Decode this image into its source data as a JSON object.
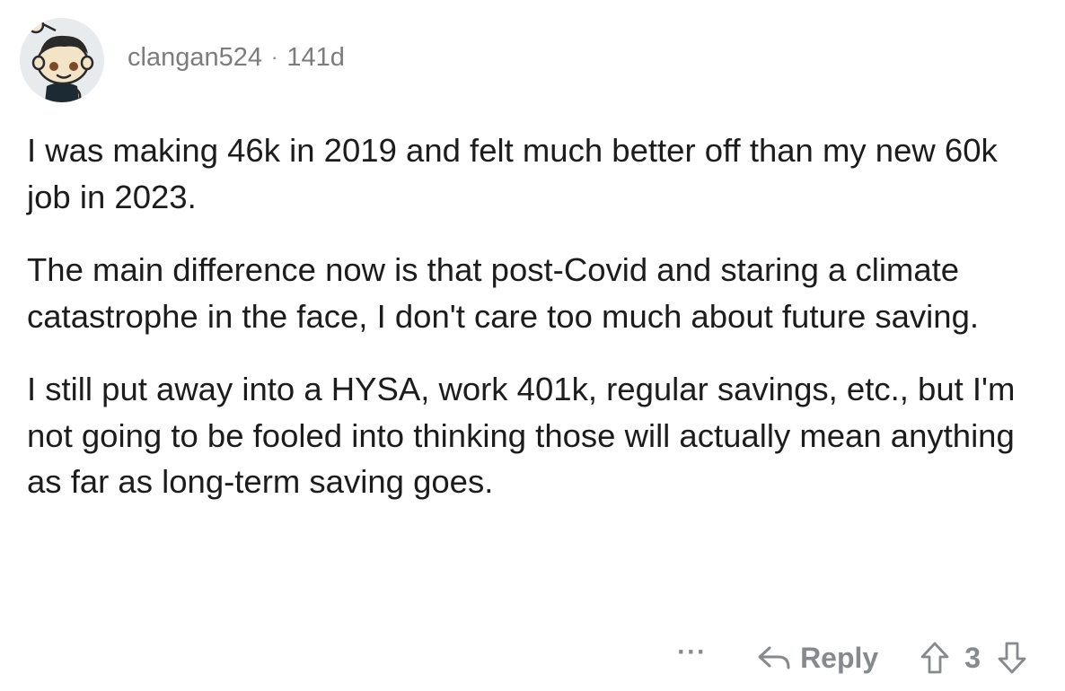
{
  "comment": {
    "username": "clangan524",
    "separator": "·",
    "age": "141d",
    "paragraphs": [
      "I was making 46k in 2019 and felt much better off than my new 60k job in 2023.",
      "The main difference now is that post-Covid and staring a climate catastrophe in the face, I don't care too much about future saving.",
      "I still put away into a HYSA, work 401k, regular savings, etc., but I'm not going to be fooled into thinking those will actually mean anything as far as long-term saving goes."
    ],
    "actions": {
      "more": "···",
      "reply_label": "Reply",
      "vote_count": "3"
    }
  },
  "icons": {
    "avatar": "snoo-avatar",
    "reply": "reply-arrow-icon",
    "upvote": "upvote-arrow-icon",
    "downvote": "downvote-arrow-icon"
  },
  "colors": {
    "text": "#1c1c1c",
    "meta": "#7c7c7c",
    "action": "#878a8c"
  }
}
